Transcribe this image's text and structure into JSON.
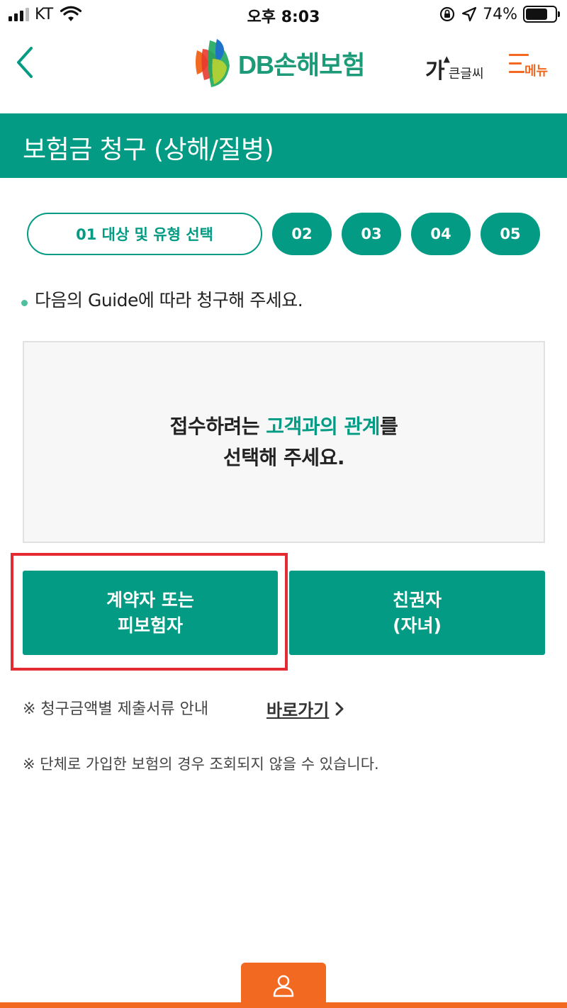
{
  "status_bar": {
    "carrier": "KT",
    "time": "오후 8:03",
    "battery_percent": "74%",
    "battery_level": 0.74
  },
  "header": {
    "logo_text": "DB손해보험",
    "font_size_big": "가",
    "font_size_small": "큰글씨",
    "menu_label": "메뉴",
    "accent_color": "#1d9b78",
    "menu_color": "#f26a22"
  },
  "page": {
    "title": "보험금 청구 (상해/질병)",
    "title_bg_color": "#039b83"
  },
  "steps": {
    "active": "01 대상 및 유형 선택",
    "others": [
      "02",
      "03",
      "04",
      "05"
    ]
  },
  "guide": {
    "text": "다음의 Guide에 따라 청구해 주세요."
  },
  "info_box": {
    "line1_prefix": "접수하려는 ",
    "line1_highlight": "고객과의 관계",
    "line1_suffix": "를",
    "line2": "선택해 주세요."
  },
  "choices": {
    "policyholder_line1": "계약자 또는",
    "policyholder_line2": "피보험자",
    "relative_line1": "친권자",
    "relative_line2": "(자녀)"
  },
  "notes": {
    "documents_label": "※ 청구금액별 제출서류 안내",
    "documents_link": "바로가기",
    "group_notice": "※ 단체로 가입한 보험의 경우 조회되지 않을 수 있습니다."
  }
}
